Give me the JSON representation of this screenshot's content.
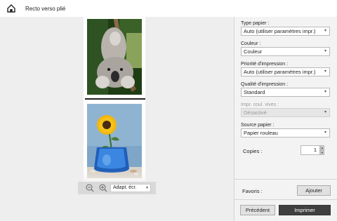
{
  "window": {
    "title": "Recto verso plié",
    "home_icon": "home-icon"
  },
  "preview": {
    "images": [
      "koala-photo",
      "sunflower-vase-photo"
    ],
    "zoom": {
      "zoom_out_icon": "zoom-out-icon",
      "zoom_in_icon": "zoom-in-icon",
      "fit_value": "Adapt. écr."
    }
  },
  "settings": {
    "paper_type": {
      "label": "Type papier :",
      "value": "Auto (utiliser paramètres impr.)"
    },
    "color": {
      "label": "Couleur :",
      "value": "Couleur"
    },
    "print_priority": {
      "label": "Priorité d'impression :",
      "value": "Auto (utiliser paramètres impr.)"
    },
    "print_quality": {
      "label": "Qualité d'impression :",
      "value": "Standard"
    },
    "vivid_color": {
      "label": "Impr. coul. vives :",
      "value": "Désactivé"
    },
    "paper_source": {
      "label": "Source papier :",
      "value": "Papier rouleau"
    },
    "copies": {
      "label": "Copies :",
      "value": "1"
    },
    "favorites": {
      "label": "Favoris :",
      "add_button": "Ajouter"
    },
    "buttons": {
      "previous": "Précédent",
      "print": "Imprimer"
    }
  },
  "colors": {
    "preview_bg": "#eeeeee",
    "panel_bg": "#f3f3f3",
    "print_button": "#3f3f3f"
  }
}
